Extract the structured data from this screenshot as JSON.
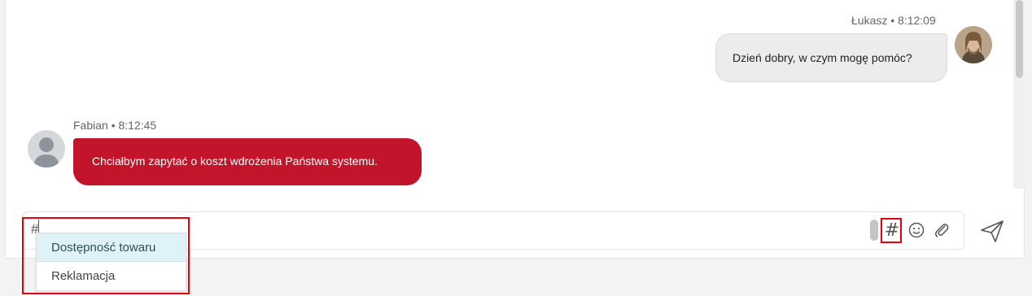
{
  "messages": [
    {
      "author": "Łukasz",
      "time": "8:12:09",
      "meta": "Łukasz • 8:12:09",
      "text": "Dzień dobry, w czym mogę pomóc?",
      "side": "right"
    },
    {
      "author": "Fabian",
      "time": "8:12:45",
      "meta": "Fabian • 8:12:45",
      "text": "Chciałbym zapytać o koszt wdrożenia Państwa systemu.",
      "side": "left"
    }
  ],
  "composer": {
    "value": "#"
  },
  "suggestions": [
    {
      "label": "Dostępność towaru",
      "selected": true
    },
    {
      "label": "Reklamacja",
      "selected": false
    }
  ],
  "toolbar": {
    "hashtag_icon": "#",
    "icons": [
      "hashtag-icon",
      "emoji-icon",
      "paperclip-icon",
      "send-icon"
    ]
  },
  "colors": {
    "user_bubble": "#c2152b",
    "agent_bubble": "#ececec",
    "highlight": "#e3000f",
    "suggestion_selected": "#dff2f8"
  }
}
